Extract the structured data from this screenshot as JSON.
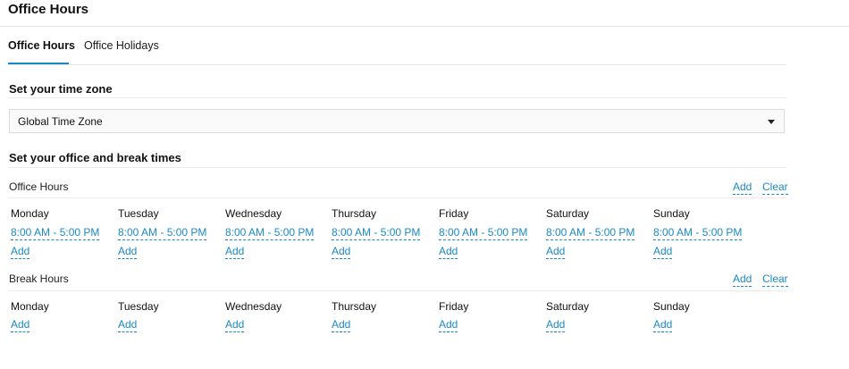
{
  "page": {
    "title": "Office Hours"
  },
  "tabs": [
    {
      "label": "Office Hours",
      "active": true
    },
    {
      "label": "Office Holidays",
      "active": false
    }
  ],
  "timezone": {
    "heading": "Set your time zone",
    "selected": "Global Time Zone"
  },
  "times": {
    "heading": "Set your office and break times",
    "office_hours": {
      "label": "Office Hours",
      "add_label": "Add",
      "clear_label": "Clear",
      "days": [
        {
          "name": "Monday",
          "range": "8:00 AM - 5:00 PM",
          "add": "Add"
        },
        {
          "name": "Tuesday",
          "range": "8:00 AM - 5:00 PM",
          "add": "Add"
        },
        {
          "name": "Wednesday",
          "range": "8:00 AM - 5:00 PM",
          "add": "Add"
        },
        {
          "name": "Thursday",
          "range": "8:00 AM - 5:00 PM",
          "add": "Add"
        },
        {
          "name": "Friday",
          "range": "8:00 AM - 5:00 PM",
          "add": "Add"
        },
        {
          "name": "Saturday",
          "range": "8:00 AM - 5:00 PM",
          "add": "Add"
        },
        {
          "name": "Sunday",
          "range": "8:00 AM - 5:00 PM",
          "add": "Add"
        }
      ]
    },
    "break_hours": {
      "label": "Break Hours",
      "add_label": "Add",
      "clear_label": "Clear",
      "days": [
        {
          "name": "Monday",
          "add": "Add"
        },
        {
          "name": "Tuesday",
          "add": "Add"
        },
        {
          "name": "Wednesday",
          "add": "Add"
        },
        {
          "name": "Thursday",
          "add": "Add"
        },
        {
          "name": "Friday",
          "add": "Add"
        },
        {
          "name": "Saturday",
          "add": "Add"
        },
        {
          "name": "Sunday",
          "add": "Add"
        }
      ]
    }
  },
  "colors": {
    "accent": "#1a8ac7",
    "rule": "#e6e6e6"
  }
}
